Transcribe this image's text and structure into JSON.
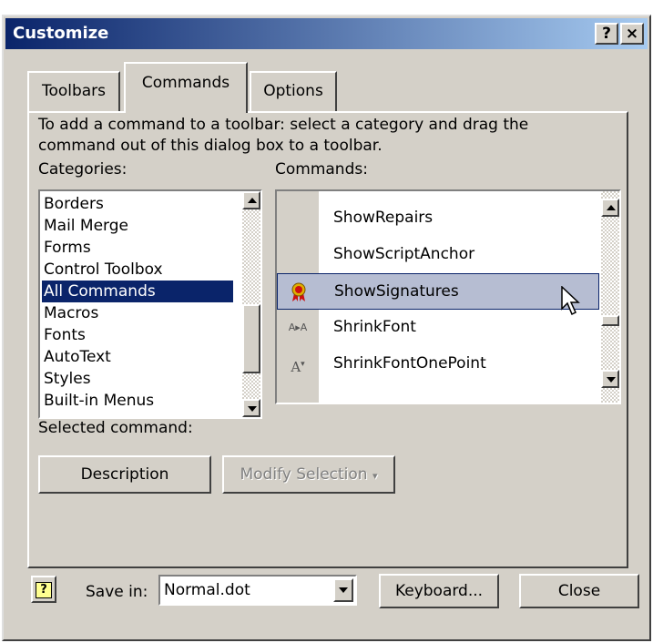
{
  "window": {
    "title": "Customize",
    "help_button": "?",
    "close_button": "×"
  },
  "tabs": [
    {
      "label": "Toolbars"
    },
    {
      "label": "Commands"
    },
    {
      "label": "Options"
    }
  ],
  "active_tab": "Commands",
  "instructions": {
    "line1": "To add a command to a toolbar: select a category and drag the",
    "line2": "command out of this dialog box to a toolbar."
  },
  "categories": {
    "label": "Categories:",
    "items": [
      {
        "label": "Borders"
      },
      {
        "label": "Mail Merge"
      },
      {
        "label": "Forms"
      },
      {
        "label": "Control Toolbox"
      },
      {
        "label": "All Commands"
      },
      {
        "label": "Macros"
      },
      {
        "label": "Fonts"
      },
      {
        "label": "AutoText"
      },
      {
        "label": "Styles"
      },
      {
        "label": "Built-in Menus"
      }
    ],
    "selected": "All Commands"
  },
  "commands": {
    "label": "Commands:",
    "items": [
      {
        "label": "ShowRepairs",
        "icon": ""
      },
      {
        "label": "ShowScriptAnchor",
        "icon": ""
      },
      {
        "label": "ShowSignatures",
        "icon": "signature-ribbon-icon"
      },
      {
        "label": "ShrinkFont",
        "icon": "shrink-font-icon"
      },
      {
        "label": "ShrinkFontOnePoint",
        "icon": "shrink-font-one-point-icon"
      }
    ],
    "selected": "ShowSignatures"
  },
  "selected_command": {
    "label": "Selected command:",
    "description_button": "Description",
    "modify_selection_button": "Modify Selection"
  },
  "footer": {
    "save_in_label": "Save in:",
    "save_in_value": "Normal.dot",
    "keyboard_button": "Keyboard...",
    "close_button": "Close"
  },
  "colors": {
    "dialog_bg": "#d4d0c8",
    "titlebar_start": "#0a246a",
    "titlebar_end": "#a6caf0",
    "selection": "#0a246a",
    "command_highlight": "#b6bdd2"
  }
}
